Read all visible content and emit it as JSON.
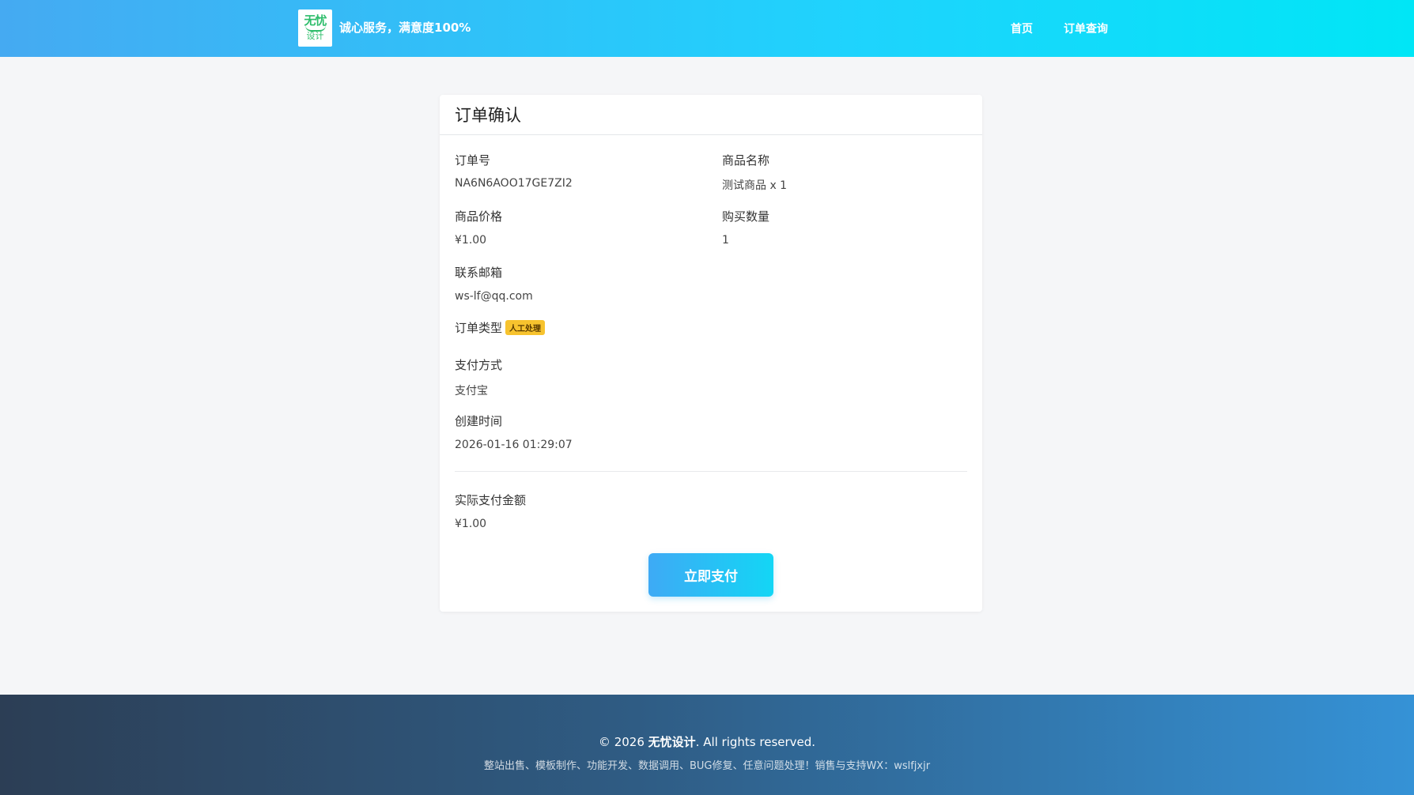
{
  "header": {
    "logo_top": "无忧",
    "logo_bottom": "设计",
    "slogan": "诚心服务，满意度100%",
    "nav": {
      "home": "首页",
      "order_query": "订单查询"
    }
  },
  "card": {
    "title": "订单确认",
    "order_no_label": "订单号",
    "order_no": "NA6N6AOO17GE7ZI2",
    "product_name_label": "商品名称",
    "product_name": "测试商品 x 1",
    "price_label": "商品价格",
    "price": "¥1.00",
    "quantity_label": "购买数量",
    "quantity": "1",
    "email_label": "联系邮箱",
    "email": "ws-lf@qq.com",
    "order_type_label": "订单类型",
    "order_type_badge": "人工处理",
    "payment_method_label": "支付方式",
    "payment_method": "支付宝",
    "created_time_label": "创建时间",
    "created_time": "2026-01-16 01:29:07",
    "actual_amount_label": "实际支付金额",
    "actual_amount": "¥1.00",
    "pay_button": "立即支付"
  },
  "footer": {
    "copyright_prefix": "© 2026 ",
    "brand": "无忧设计",
    "copyright_suffix": ". All rights reserved.",
    "services": "整站出售、模板制作、功能开发、数据调用、BUG修复、任意问题处理！销售与支持WX：wslfjxjr"
  },
  "colors": {
    "header_gradient_start": "#45aaf2",
    "header_gradient_end": "#00e6f6",
    "badge": "#f7c32e",
    "button_gradient_start": "#3eaaf5",
    "button_gradient_end": "#13d6f5",
    "footer_gradient_start": "#2c3e55",
    "footer_gradient_end": "#3592d6"
  }
}
